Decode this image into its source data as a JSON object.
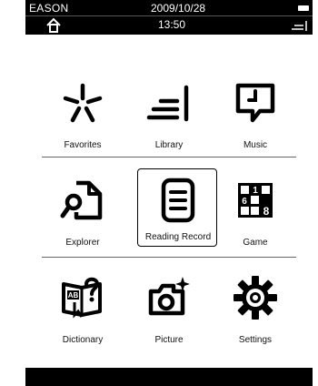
{
  "status_bar": {
    "brand": "EASON",
    "date": "2009/10/28",
    "time": "13:50",
    "home_icon": "home-icon",
    "menu_icon": "menu-lines-icon",
    "battery_icon": "battery-icon"
  },
  "apps": {
    "row1": [
      {
        "label": "Favorites",
        "icon": "asterisk-icon"
      },
      {
        "label": "Library",
        "icon": "library-lines-icon"
      },
      {
        "label": "Music",
        "icon": "music-clock-icon"
      }
    ],
    "row2": [
      {
        "label": "Explorer",
        "icon": "search-document-icon"
      },
      {
        "label": "Reading Record",
        "icon": "reading-record-icon",
        "selected": true
      },
      {
        "label": "Game",
        "icon": "sudoku-grid-icon"
      }
    ],
    "row3": [
      {
        "label": "Dictionary",
        "icon": "dictionary-icon"
      },
      {
        "label": "Picture",
        "icon": "camera-icon"
      },
      {
        "label": "Settings",
        "icon": "gear-icon"
      }
    ]
  },
  "colors": {
    "background": "#ffffff",
    "bar": "#000000",
    "text": "#111111"
  }
}
